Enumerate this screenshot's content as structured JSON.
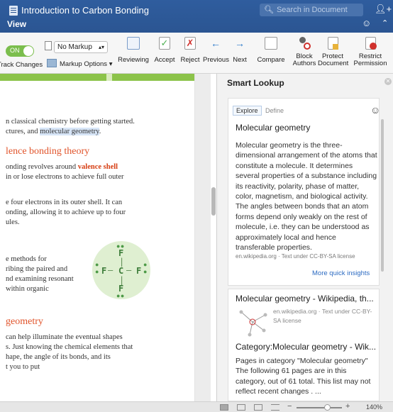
{
  "window": {
    "title": "Introduction to Carbon Bonding",
    "search_placeholder": "Search in Document",
    "menu_view": "View"
  },
  "ribbon": {
    "toggle_label": "ON",
    "track_changes_label": "Track Changes",
    "markup_select_value": "No Markup",
    "markup_options_label": "Markup Options",
    "reviewing_label": "Reviewing",
    "accept_label": "Accept",
    "reject_label": "Reject",
    "previous_label": "Previous",
    "next_label": "Next",
    "compare_label": "Compare",
    "block_authors_label": "Block\nAuthors",
    "protect_document_label": "Protect\nDocument",
    "restrict_permission_label": "Restrict\nPermission"
  },
  "document": {
    "line1": "n classical chemistry before getting started.",
    "line2_pre": "ctures, and ",
    "line2_highlight": "molecular geometry",
    "line2_post": ".",
    "heading1": "lence bonding theory",
    "line3_pre": "onding revolves around ",
    "line3_bold": "valence shell",
    "line4": "in or lose electrons to achieve full outer",
    "line5": "e four electrons in its outer shell. It can",
    "line6": "onding, allowing it to achieve up to four",
    "line7": "ules.",
    "line8": "e methods for",
    "line9": "ribing the paired and",
    "line10": "nd examining resonant",
    "line11": "within organic",
    "heading2": "geometry",
    "line12": "can help illuminate the eventual shapes",
    "line13": "s. Just knowing the chemical elements that",
    "line14": "hape, the angle of its bonds, and its",
    "line15": "t you to put",
    "molecule": {
      "center": "C",
      "top": "F",
      "bottom": "F",
      "left": "F",
      "right": "F"
    }
  },
  "smart_lookup": {
    "title": "Smart Lookup",
    "tab_explore": "Explore",
    "tab_define": "Define",
    "card1_title": "Molecular geometry",
    "card1_body": "Molecular geometry is the three-dimensional arrangement of the atoms that constitute a molecule. It determines several properties of a substance including its reactivity, polarity, phase of matter, color, magnetism, and biological activity. The angles between bonds that an atom forms depend only weakly on the rest of molecule, i.e. they can be understood as approximately local and hence transferable properties.",
    "card1_source": "en.wikipedia.org · Text under CC-BY-SA license",
    "more_insights": "More quick insights",
    "card2_title": "Molecular geometry - Wikipedia, th...",
    "card2_source": "en.wikipedia.org · Text under CC-BY-SA license",
    "card2_subtitle": "Category:Molecular geometry - Wik...",
    "card2_body": "Pages in category \"Molecular geometry\" The following 61 pages are in this category, out of 61 total. This list may not reflect recent changes . ..."
  },
  "statusbar": {
    "zoom_value": "140%",
    "zoom_level_percent": 140
  }
}
